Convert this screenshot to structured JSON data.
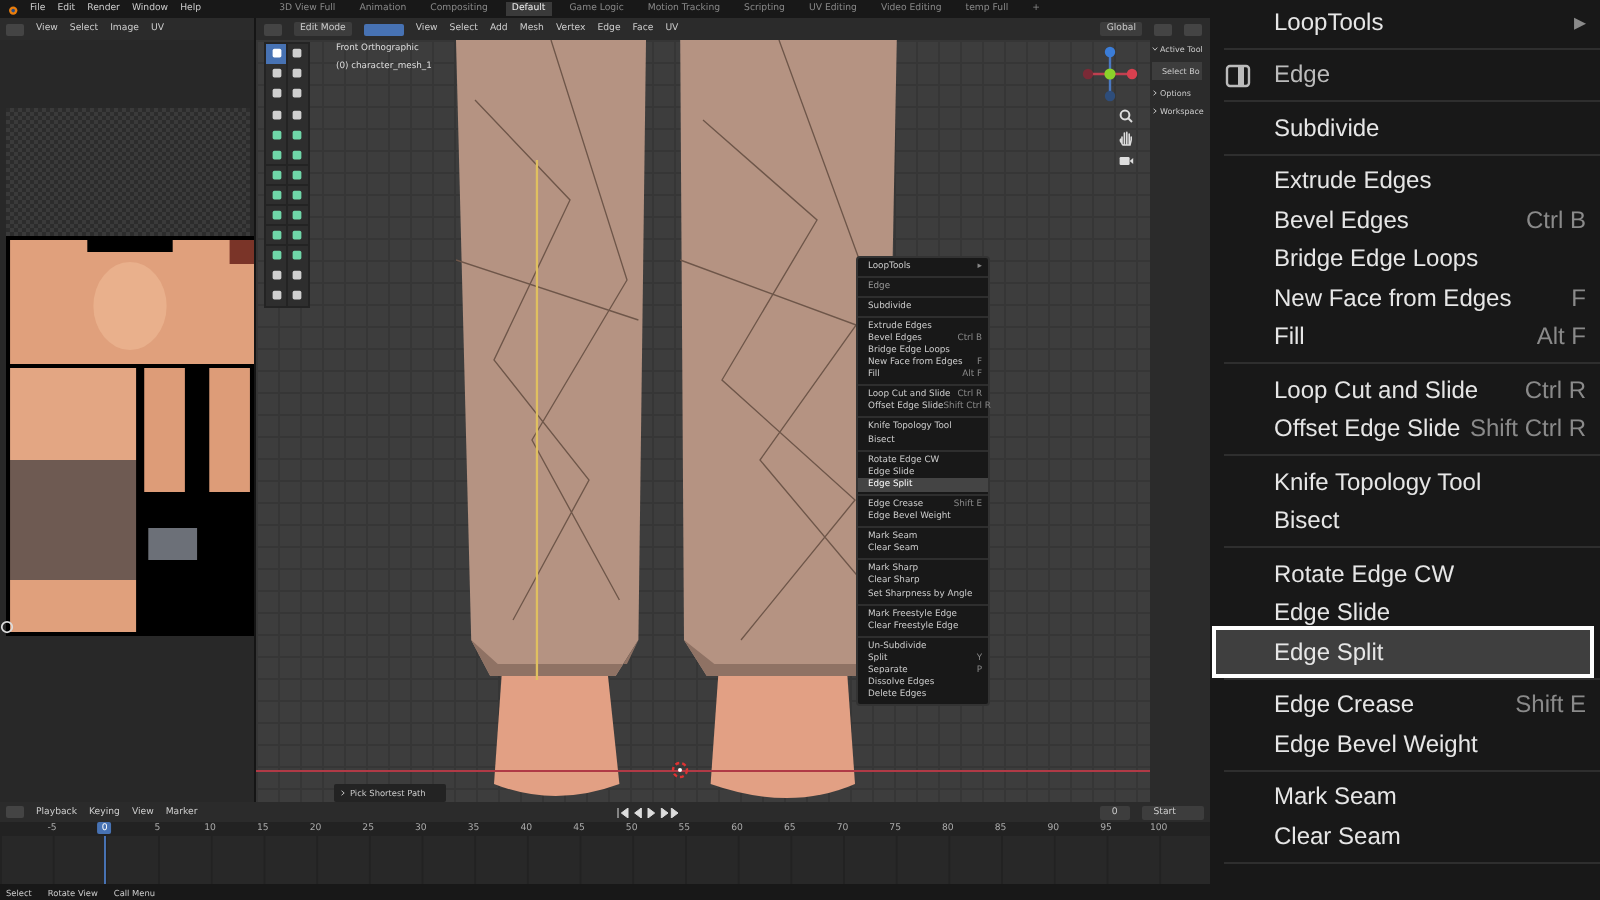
{
  "top_bar": {
    "menus": [
      "File",
      "Edit",
      "Render",
      "Window",
      "Help"
    ],
    "workspaces": [
      {
        "label": "3D View Full",
        "selected": false
      },
      {
        "label": "Animation",
        "selected": false
      },
      {
        "label": "Compositing",
        "selected": false
      },
      {
        "label": "Default",
        "selected": true
      },
      {
        "label": "Game Logic",
        "selected": false
      },
      {
        "label": "Motion Tracking",
        "selected": false
      },
      {
        "label": "Scripting",
        "selected": false
      },
      {
        "label": "UV Editing",
        "selected": false
      },
      {
        "label": "Video Editing",
        "selected": false
      },
      {
        "label": "temp Full",
        "selected": false
      }
    ],
    "add_workspace": "+"
  },
  "uv_editor": {
    "menus": [
      "View",
      "Select",
      "Image",
      "UV"
    ]
  },
  "viewport": {
    "mode": "Edit Mode",
    "menus": [
      "View",
      "Select",
      "Add",
      "Mesh",
      "Vertex",
      "Edge",
      "Face",
      "UV"
    ],
    "orientation": "Global",
    "view_name": "Front Orthographic",
    "object_name": "(0) character_mesh_1",
    "sidebar": {
      "title": "Active Tool",
      "tool": "Select Bo",
      "panels": [
        "Options",
        "Workspace"
      ]
    },
    "last_operator": "Pick Shortest Path",
    "context_menu": {
      "groups": [
        [
          {
            "kind": "submenu",
            "label": "LoopTools",
            "shortcut": "▸",
            "selected": false
          }
        ],
        [
          {
            "kind": "header",
            "label": "Edge",
            "selected": false
          }
        ],
        [
          {
            "kind": "item",
            "label": "Subdivide",
            "selected": false
          }
        ],
        [
          {
            "kind": "item",
            "label": "Extrude Edges",
            "selected": false
          },
          {
            "kind": "item",
            "label": "Bevel Edges",
            "shortcut": "Ctrl B",
            "selected": false
          },
          {
            "kind": "item",
            "label": "Bridge Edge Loops",
            "selected": false
          },
          {
            "kind": "item",
            "label": "New Face from Edges",
            "shortcut": "F",
            "selected": false
          },
          {
            "kind": "item",
            "label": "Fill",
            "shortcut": "Alt F",
            "selected": false
          }
        ],
        [
          {
            "kind": "item",
            "label": "Loop Cut and Slide",
            "shortcut": "Ctrl R",
            "selected": false
          },
          {
            "kind": "item",
            "label": "Offset Edge Slide",
            "shortcut": "Shift Ctrl R",
            "selected": false
          }
        ],
        [
          {
            "kind": "item",
            "label": "Knife Topology Tool",
            "selected": false
          },
          {
            "kind": "item",
            "label": "Bisect",
            "selected": false
          }
        ],
        [
          {
            "kind": "item",
            "label": "Rotate Edge CW",
            "selected": false
          },
          {
            "kind": "item",
            "label": "Edge Slide",
            "selected": false
          },
          {
            "kind": "item",
            "label": "Edge Split",
            "selected": true
          }
        ],
        [
          {
            "kind": "item",
            "label": "Edge Crease",
            "shortcut": "Shift E",
            "selected": false
          },
          {
            "kind": "item",
            "label": "Edge Bevel Weight",
            "selected": false
          }
        ],
        [
          {
            "kind": "item",
            "label": "Mark Seam",
            "selected": false
          },
          {
            "kind": "item",
            "label": "Clear Seam",
            "selected": false
          }
        ],
        [
          {
            "kind": "item",
            "label": "Mark Sharp",
            "selected": false
          },
          {
            "kind": "item",
            "label": "Clear Sharp",
            "selected": false
          },
          {
            "kind": "item",
            "label": "Set Sharpness by Angle",
            "selected": false
          }
        ],
        [
          {
            "kind": "item",
            "label": "Mark Freestyle Edge",
            "selected": false
          },
          {
            "kind": "item",
            "label": "Clear Freestyle Edge",
            "selected": false
          }
        ],
        [
          {
            "kind": "item",
            "label": "Un-Subdivide",
            "selected": false
          },
          {
            "kind": "item",
            "label": "Split",
            "shortcut": "Y",
            "selected": false
          },
          {
            "kind": "item",
            "label": "Separate",
            "shortcut": "P",
            "selected": false
          },
          {
            "kind": "item",
            "label": "Dissolve Edges",
            "selected": false
          },
          {
            "kind": "item",
            "label": "Delete Edges",
            "selected": false
          }
        ]
      ]
    }
  },
  "timeline": {
    "menus": [
      "Playback",
      "Keying",
      "View",
      "Marker"
    ],
    "frame_field": "0",
    "start_label": "Start",
    "frames": [
      {
        "label": "-5",
        "selected": false
      },
      {
        "label": "0",
        "selected": true
      },
      {
        "label": "5",
        "selected": false
      },
      {
        "label": "10",
        "selected": false
      },
      {
        "label": "15",
        "selected": false
      },
      {
        "label": "20",
        "selected": false
      },
      {
        "label": "25",
        "selected": false
      },
      {
        "label": "30",
        "selected": false
      },
      {
        "label": "35",
        "selected": false
      },
      {
        "label": "40",
        "selected": false
      },
      {
        "label": "45",
        "selected": false
      },
      {
        "label": "50",
        "selected": false
      },
      {
        "label": "55",
        "selected": false
      },
      {
        "label": "60",
        "selected": false
      },
      {
        "label": "65",
        "selected": false
      },
      {
        "label": "70",
        "selected": false
      },
      {
        "label": "75",
        "selected": false
      },
      {
        "label": "80",
        "selected": false
      },
      {
        "label": "85",
        "selected": false
      },
      {
        "label": "90",
        "selected": false
      },
      {
        "label": "95",
        "selected": false
      },
      {
        "label": "100",
        "selected": false
      }
    ]
  },
  "status_bar": [
    "Select",
    "Rotate View",
    "Call Menu"
  ],
  "zoomed_menu": {
    "groups": [
      [
        {
          "kind": "submenu",
          "label": "LoopTools",
          "shortcut": "▸",
          "selected": false
        }
      ],
      [
        {
          "kind": "header",
          "label": "Edge",
          "selected": false
        }
      ],
      [
        {
          "kind": "item",
          "label": "Subdivide",
          "selected": false
        }
      ],
      [
        {
          "kind": "item",
          "label": "Extrude Edges",
          "selected": false
        },
        {
          "kind": "item",
          "label": "Bevel Edges",
          "shortcut": "Ctrl B",
          "selected": false
        },
        {
          "kind": "item",
          "label": "Bridge Edge Loops",
          "selected": false
        },
        {
          "kind": "item",
          "label": "New Face from Edges",
          "shortcut": "F",
          "selected": false
        },
        {
          "kind": "item",
          "label": "Fill",
          "shortcut": "Alt F",
          "selected": false
        }
      ],
      [
        {
          "kind": "item",
          "label": "Loop Cut and Slide",
          "shortcut": "Ctrl R",
          "selected": false
        },
        {
          "kind": "item",
          "label": "Offset Edge Slide",
          "shortcut": "Shift Ctrl R",
          "selected": false
        }
      ],
      [
        {
          "kind": "item",
          "label": "Knife Topology Tool",
          "selected": false
        },
        {
          "kind": "item",
          "label": "Bisect",
          "selected": false
        }
      ],
      [
        {
          "kind": "item",
          "label": "Rotate Edge CW",
          "selected": false
        },
        {
          "kind": "item",
          "label": "Edge Slide",
          "selected": false
        },
        {
          "kind": "item",
          "label": "Edge Split",
          "selected": true
        }
      ],
      [
        {
          "kind": "item",
          "label": "Edge Crease",
          "shortcut": "Shift E",
          "selected": false
        },
        {
          "kind": "item",
          "label": "Edge Bevel Weight",
          "selected": false
        }
      ],
      [
        {
          "kind": "item",
          "label": "Mark Seam",
          "selected": false
        },
        {
          "kind": "item",
          "label": "Clear Seam",
          "selected": false
        }
      ]
    ]
  }
}
